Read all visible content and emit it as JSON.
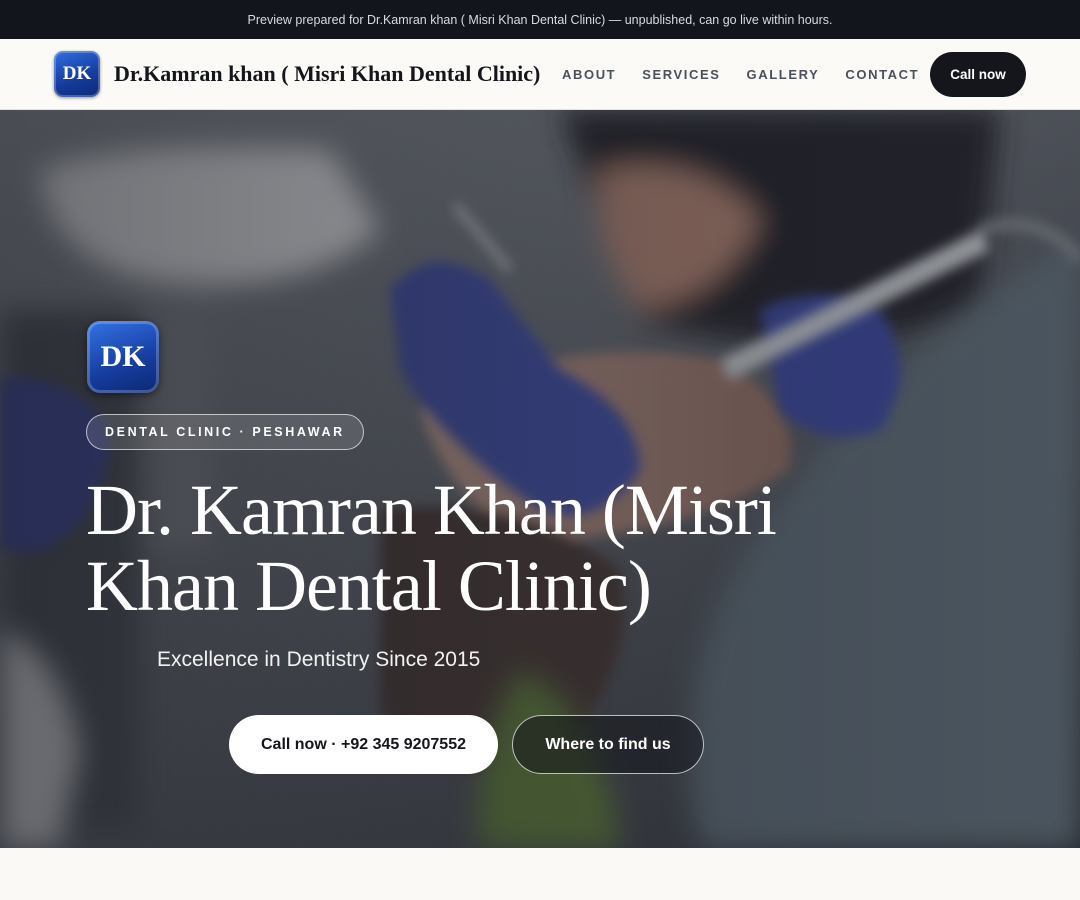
{
  "preview_bar": {
    "text": "Preview prepared for Dr.Kamran khan ( Misri Khan Dental Clinic) — unpublished, can go live within hours."
  },
  "header": {
    "logo_text": "DK",
    "brand_name": "Dr.Kamran khan ( Misri Khan Dental Clinic)",
    "nav": [
      {
        "label": "ABOUT"
      },
      {
        "label": "SERVICES"
      },
      {
        "label": "GALLERY"
      },
      {
        "label": "CONTACT"
      }
    ],
    "cta_label": "Call now"
  },
  "hero": {
    "logo_text": "DK",
    "badge": "DENTAL CLINIC · PESHAWAR",
    "title": "Dr. Kamran Khan (Misri Khan Dental Clinic)",
    "tagline": "Excellence in Dentistry Since 2015",
    "primary_button": "Call now · +92 345 9207552",
    "secondary_button": "Where to find us"
  },
  "colors": {
    "preview_bar_bg": "#12151c",
    "nav_bg": "#fbfaf7",
    "cta_bg": "#14161b",
    "logo_blue": "#1a44a8",
    "glove_blue": "#3d4aa0"
  }
}
